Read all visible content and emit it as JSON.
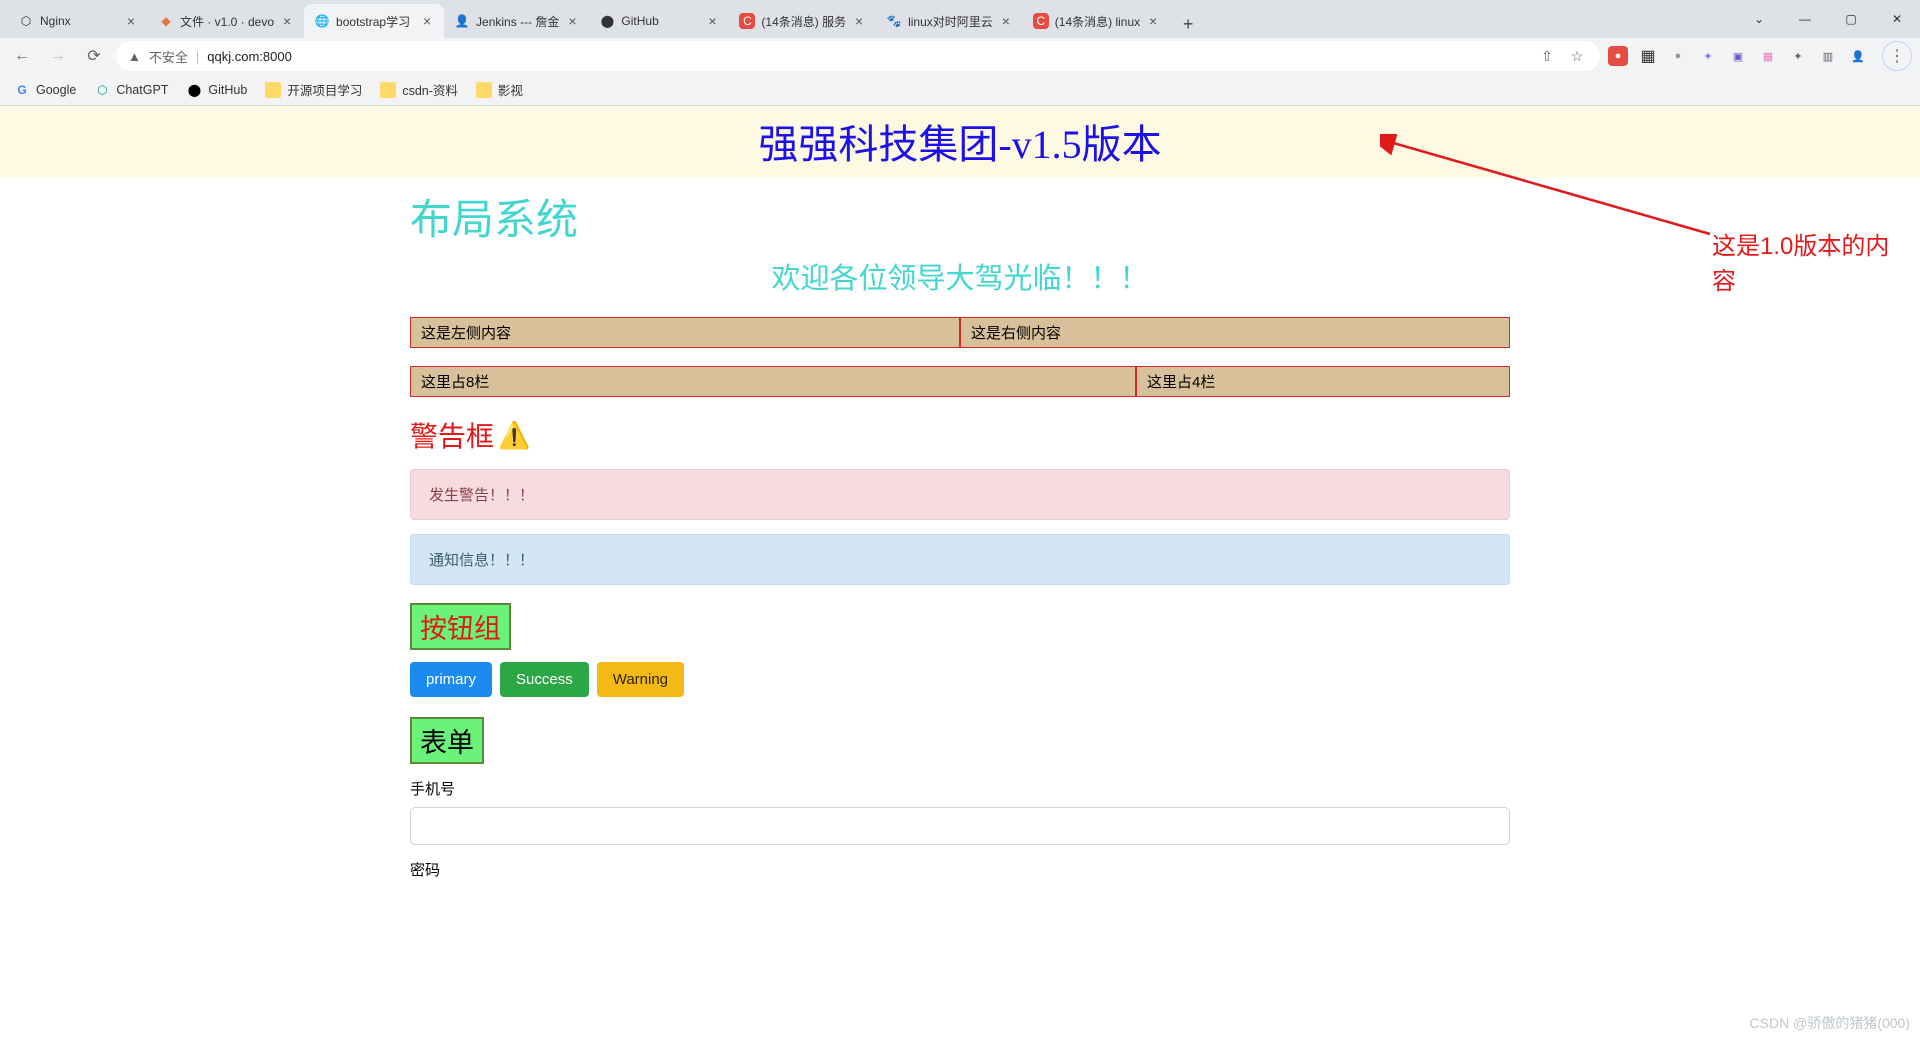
{
  "window": {
    "tabs": [
      {
        "favicon": "⬡",
        "title": "Nginx"
      },
      {
        "favicon": "🦊",
        "title": "文件 · v1.0 · devo"
      },
      {
        "favicon": "🌐",
        "title": "bootstrap学习",
        "active": true
      },
      {
        "favicon": "👤",
        "title": "Jenkins --- 詹金"
      },
      {
        "favicon": "⬤",
        "title": "GitHub"
      },
      {
        "favicon": "C",
        "title": "(14条消息) 服务"
      },
      {
        "favicon": "🐾",
        "title": "linux对时阿里云"
      },
      {
        "favicon": "C",
        "title": "(14条消息) linux"
      }
    ],
    "addrbar": {
      "not_secure": "不安全",
      "url": "qqkj.com:8000"
    },
    "bookmarks": [
      {
        "icon": "G",
        "label": "Google"
      },
      {
        "icon": "⬡",
        "label": "ChatGPT"
      },
      {
        "icon": "⬤",
        "label": "GitHub"
      },
      {
        "icon": "folder",
        "label": "开源项目学习"
      },
      {
        "icon": "folder",
        "label": "csdn-资料"
      },
      {
        "icon": "folder",
        "label": "影视"
      }
    ]
  },
  "page": {
    "banner_title": "强强科技集团-v1.5版本",
    "layout_title": "布局系统",
    "welcome": "欢迎各位领导大驾光临！！！",
    "row1": {
      "left": "这是左侧内容",
      "right": "这是右侧内容"
    },
    "row2": {
      "c8": "这里占8栏",
      "c4": "这里占4栏"
    },
    "warn_heading": "警告框",
    "alert_warn": "发生警告！！！",
    "alert_info": "通知信息！！！",
    "btn_group_title": "按钮组",
    "buttons": {
      "primary": "primary",
      "success": "Success",
      "warning": "Warning"
    },
    "form_title": "表单",
    "form": {
      "phone_label": "手机号",
      "password_label": "密码"
    },
    "annotation": "这是1.0版本的内容"
  },
  "watermark": "CSDN @骄傲的猪猪(000)"
}
